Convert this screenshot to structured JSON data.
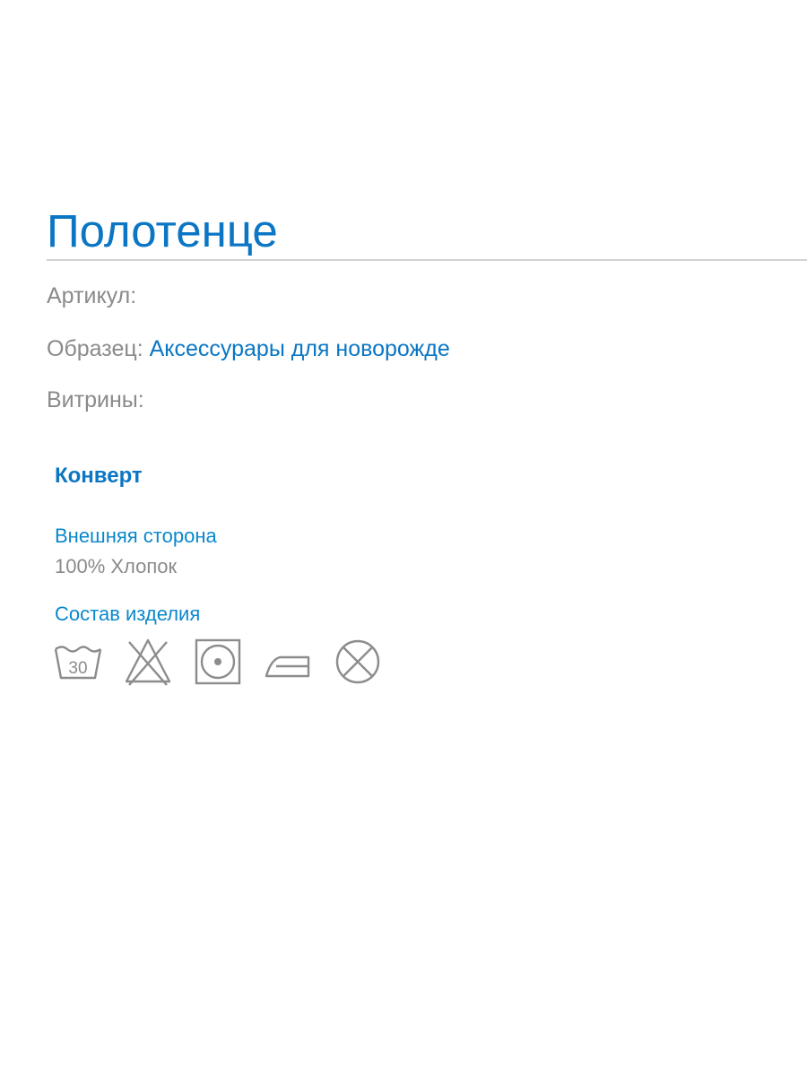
{
  "product": {
    "title": "Полотенце"
  },
  "meta": {
    "article_label": "Артикул:",
    "article_value": "",
    "sample_label": "Образец:",
    "sample_value": "Аксессурары для новорожде",
    "showcase_label": "Витрины:",
    "showcase_value": ""
  },
  "details": {
    "section_title": "Конверт",
    "outer_side_label": "Внешняя сторона",
    "outer_side_value": "100% Хлопок",
    "composition_label": "Состав изделия",
    "wash_temperature": "30"
  },
  "care_icons": [
    "wash-30-icon",
    "do-not-bleach-icon",
    "tumble-dry-icon",
    "iron-icon",
    "do-not-dry-clean-icon"
  ],
  "colors": {
    "accent": "#0a76c4",
    "muted_text": "#8a8a8a",
    "icon": "#8c8c8c",
    "rule": "#cfd3d6"
  }
}
